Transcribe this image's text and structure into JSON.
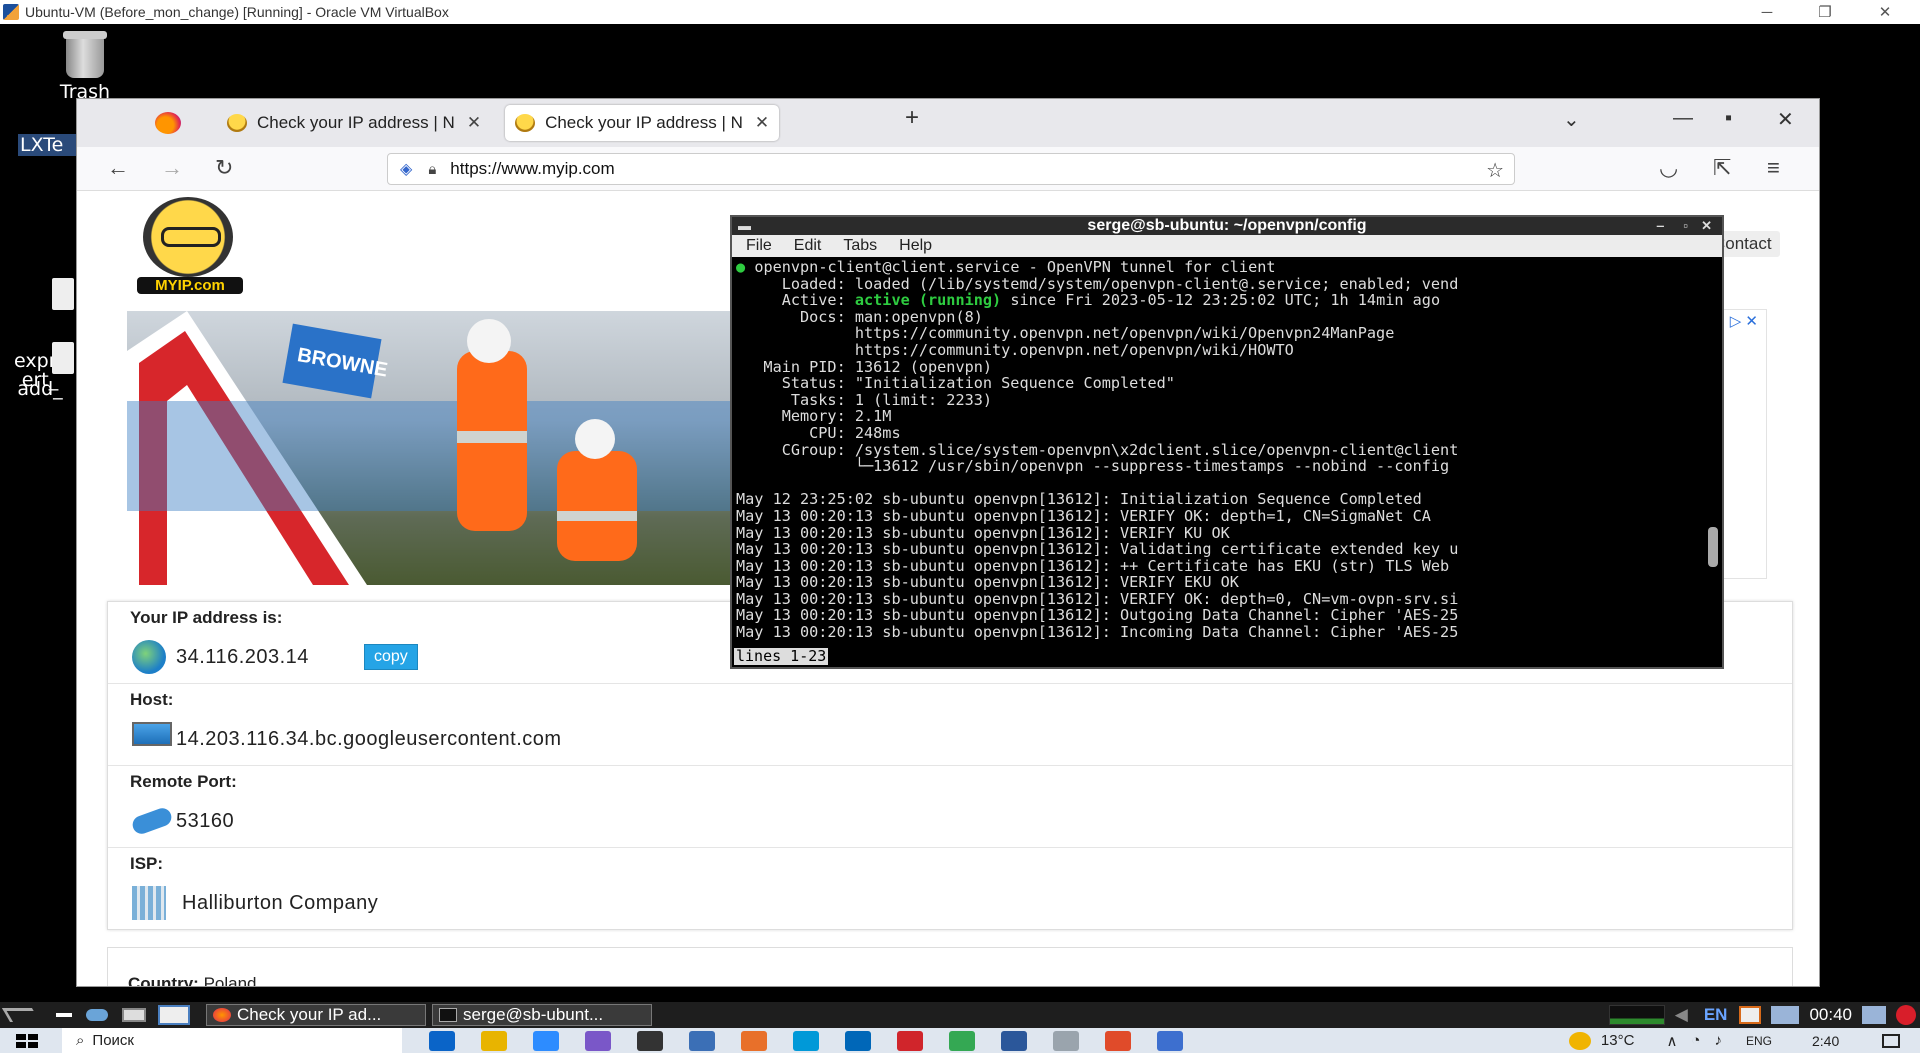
{
  "vbox": {
    "title": "Ubuntu-VM (Before_mon_change) [Running] - Oracle VM VirtualBox",
    "min": "─",
    "max": "❐",
    "close": "✕"
  },
  "desktop": {
    "icons": [
      "Trash",
      "LXTe",
      "expr_\nert_",
      "add_"
    ]
  },
  "browser": {
    "tabs": [
      {
        "label": "Check your IP address | N",
        "close": "✕"
      },
      {
        "label": "Check your IP address | N",
        "close": "✕"
      }
    ],
    "new_tab": "+",
    "list_all": "⌄",
    "win_min": "—",
    "win_max": "▪",
    "win_close": "✕",
    "back": "←",
    "forward": "→",
    "reload": "↻",
    "url": "https://www.myip.com",
    "star": "☆",
    "pocket": "◡",
    "extensions": "⇱",
    "menu": "≡"
  },
  "site": {
    "logo_text": "MYIP.com",
    "contact": "Contact",
    "ip_label": "Your IP address is:",
    "ip": "34.116.203.14",
    "copy": "copy",
    "host_label": "Host:",
    "host": "14.203.116.34.bc.googleusercontent.com",
    "port_label": "Remote Port:",
    "port": "53160",
    "isp_label": "ISP:",
    "isp": "Halliburton Company",
    "country_label": "Country:",
    "country": "Poland",
    "banner_sign": "BROWNE",
    "ad_choice": "▷ ✕"
  },
  "terminal": {
    "title": "serge@sb-ubuntu: ~/openvpn/config",
    "menu": [
      "File",
      "Edit",
      "Tabs",
      "Help"
    ],
    "ctl_min": "‒",
    "ctl_max": "▫",
    "ctl_close": "✕",
    "line1": "openvpn-client@client.service - OpenVPN tunnel for client",
    "loaded": "     Loaded: loaded (/lib/systemd/system/openvpn-client@.service; enabled; vend",
    "active_pre": "     Active: ",
    "active_state": "active (running)",
    "active_post": " since Fri 2023-05-12 23:25:02 UTC; 1h 14min ago",
    "lines": [
      "       Docs: man:openvpn(8)",
      "             https://community.openvpn.net/openvpn/wiki/Openvpn24ManPage",
      "             https://community.openvpn.net/openvpn/wiki/HOWTO",
      "   Main PID: 13612 (openvpn)",
      "     Status: \"Initialization Sequence Completed\"",
      "      Tasks: 1 (limit: 2233)",
      "     Memory: 2.1M",
      "        CPU: 248ms",
      "     CGroup: /system.slice/system-openvpn\\x2dclient.slice/openvpn-client@client",
      "             └─13612 /usr/sbin/openvpn --suppress-timestamps --nobind --config ",
      "",
      "May 12 23:25:02 sb-ubuntu openvpn[13612]: Initialization Sequence Completed",
      "May 13 00:20:13 sb-ubuntu openvpn[13612]: VERIFY OK: depth=1, CN=SigmaNet CA",
      "May 13 00:20:13 sb-ubuntu openvpn[13612]: VERIFY KU OK",
      "May 13 00:20:13 sb-ubuntu openvpn[13612]: Validating certificate extended key u",
      "May 13 00:20:13 sb-ubuntu openvpn[13612]: ++ Certificate has EKU (str) TLS Web ",
      "May 13 00:20:13 sb-ubuntu openvpn[13612]: VERIFY EKU OK",
      "May 13 00:20:13 sb-ubuntu openvpn[13612]: VERIFY OK: depth=0, CN=vm-ovpn-srv.si",
      "May 13 00:20:13 sb-ubuntu openvpn[13612]: Outgoing Data Channel: Cipher 'AES-25",
      "May 13 00:20:13 sb-ubuntu openvpn[13612]: Incoming Data Channel: Cipher 'AES-25"
    ],
    "status": "lines 1-23"
  },
  "guest_panel": {
    "tasks": [
      "Check your IP ad...",
      "serge@sb-ubunt..."
    ],
    "lang": "EN",
    "clock": "00:40"
  },
  "win_taskbar": {
    "search": "Поиск",
    "temp": "13°C",
    "lang": "ENG",
    "time": "2:40",
    "app_colors": [
      "#0a64c8",
      "#e8b400",
      "#2d8cff",
      "#7a57c8",
      "#333333",
      "#3b6fb6",
      "#e8702a",
      "#0099d8",
      "#0067b8",
      "#d0252b",
      "#34a853",
      "#2b579a",
      "#9aa4ad",
      "#e04b2a",
      "#3d6fcf"
    ]
  }
}
